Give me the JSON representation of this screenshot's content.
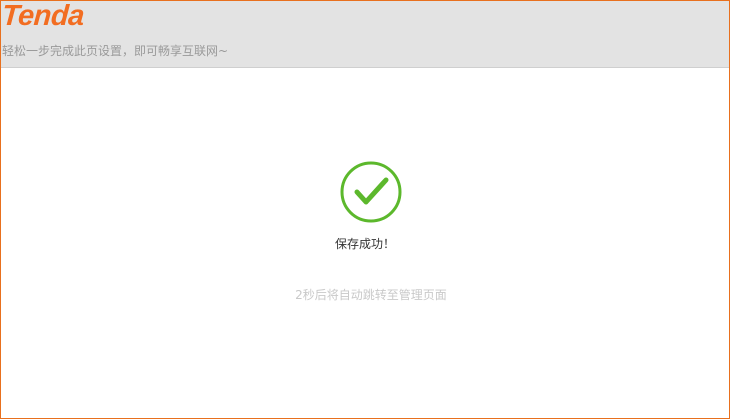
{
  "header": {
    "logo_text": "Tenda",
    "tagline": "轻松一步完成此页设置，即可畅享互联网~"
  },
  "main": {
    "status_icon": "check-circle-icon",
    "status_message": "保存成功！",
    "redirect_message": "2秒后将自动跳转至管理页面"
  },
  "colors": {
    "brand": "#f26d21",
    "success": "#5cb82c",
    "header_bg": "#e3e3e3",
    "border": "#e8701e"
  }
}
